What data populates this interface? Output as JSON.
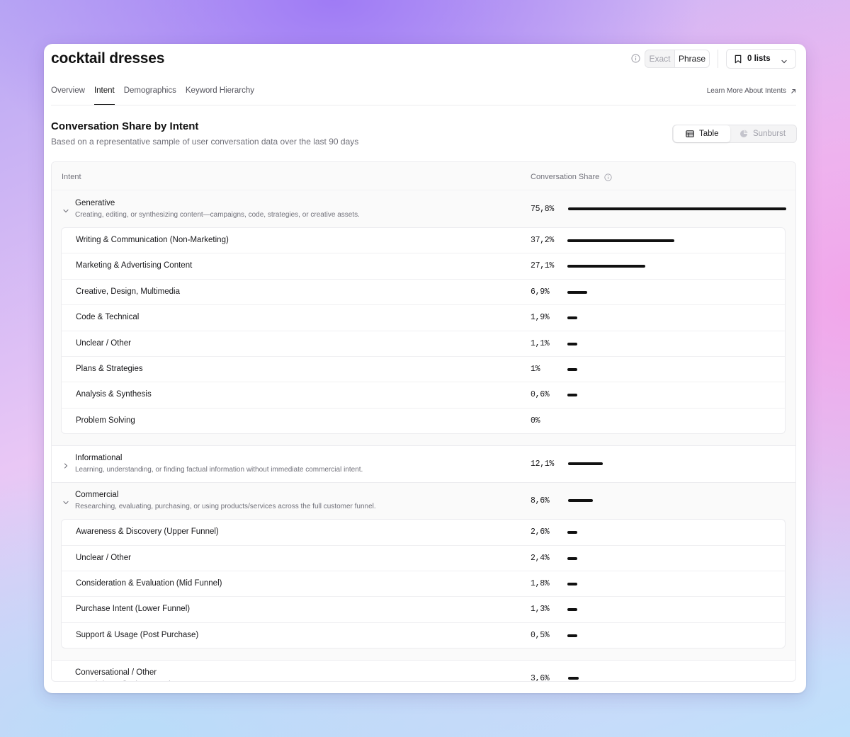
{
  "header": {
    "title": "cocktail dresses",
    "match_options": [
      "Exact",
      "Phrase"
    ],
    "match_selected": "Phrase",
    "lists_label": "0 lists"
  },
  "tabs": [
    {
      "label": "Overview",
      "active": false
    },
    {
      "label": "Intent",
      "active": true
    },
    {
      "label": "Demographics",
      "active": false
    },
    {
      "label": "Keyword Hierarchy",
      "active": false
    }
  ],
  "learn_more": "Learn More About Intents",
  "section": {
    "title": "Conversation Share by Intent",
    "subtitle": "Based on a representative sample of user conversation data over the last 90 days",
    "view_table": "Table",
    "view_sunburst": "Sunburst",
    "view_selected": "Table"
  },
  "table": {
    "col_intent": "Intent",
    "col_share": "Conversation Share",
    "groups": [
      {
        "name": "Generative",
        "desc": "Creating, editing, or synthesizing content—campaigns, code, strategies, or creative assets.",
        "pct": "75,8%",
        "value": 75.8,
        "expanded": true,
        "children": [
          {
            "name": "Writing & Communication (Non-Marketing)",
            "pct": "37,2%",
            "value": 37.2
          },
          {
            "name": "Marketing & Advertising Content",
            "pct": "27,1%",
            "value": 27.1
          },
          {
            "name": "Creative, Design, Multimedia",
            "pct": "6,9%",
            "value": 6.9
          },
          {
            "name": "Code & Technical",
            "pct": "1,9%",
            "value": 1.9
          },
          {
            "name": "Unclear / Other",
            "pct": "1,1%",
            "value": 1.1
          },
          {
            "name": "Plans & Strategies",
            "pct": "1%",
            "value": 1.0
          },
          {
            "name": "Analysis & Synthesis",
            "pct": "0,6%",
            "value": 0.6
          },
          {
            "name": "Problem Solving",
            "pct": "0%",
            "value": 0
          }
        ]
      },
      {
        "name": "Informational",
        "desc": "Learning, understanding, or finding factual information without immediate commercial intent.",
        "pct": "12,1%",
        "value": 12.1,
        "expanded": false,
        "children": []
      },
      {
        "name": "Commercial",
        "desc": "Researching, evaluating, purchasing, or using products/services across the full customer funnel.",
        "pct": "8,6%",
        "value": 8.6,
        "expanded": true,
        "children": [
          {
            "name": "Awareness & Discovery (Upper Funnel)",
            "pct": "2,6%",
            "value": 2.6
          },
          {
            "name": "Unclear / Other",
            "pct": "2,4%",
            "value": 2.4
          },
          {
            "name": "Consideration & Evaluation (Mid Funnel)",
            "pct": "1,8%",
            "value": 1.8
          },
          {
            "name": "Purchase Intent (Lower Funnel)",
            "pct": "1,3%",
            "value": 1.3
          },
          {
            "name": "Support & Usage (Post Purchase)",
            "pct": "0,5%",
            "value": 0.5
          }
        ]
      },
      {
        "name": "Conversational / Other",
        "desc": "Casual chat, reflection, or unclear requests.",
        "pct": "3,6%",
        "value": 3.6,
        "expanded": false,
        "no_chevron": true,
        "children": []
      }
    ]
  },
  "icons": {
    "info": "info-circle-icon",
    "bookmark": "bookmark-icon",
    "chevron": "chevron-down-icon",
    "external": "arrow-up-right-icon",
    "table": "table-icon",
    "sunburst": "pie-chart-icon"
  }
}
